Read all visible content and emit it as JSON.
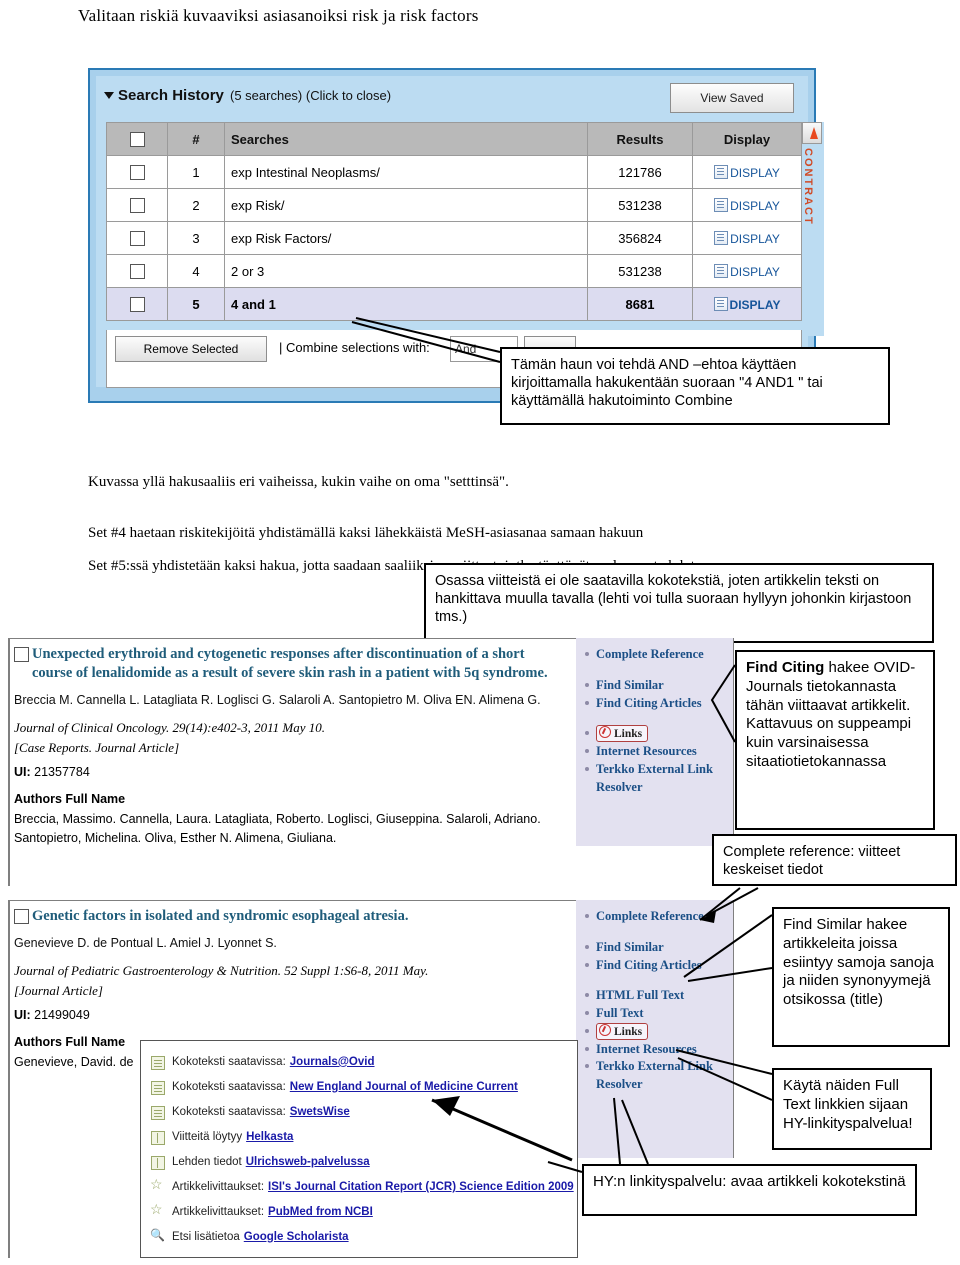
{
  "page_title": "Valitaan riskiä kuvaaviksi asiasanoiksi risk ja risk factors",
  "search_panel": {
    "header_title": "Search History",
    "header_count": "(5 searches) (Click to close)",
    "view_saved_label": "View Saved",
    "caret_icon": "triangle-down-icon",
    "columns": [
      "",
      "#",
      "Searches",
      "Results",
      "Display"
    ],
    "rows": [
      {
        "num": "1",
        "search": "exp Intestinal Neoplasms/",
        "results": "121786",
        "display": "DISPLAY"
      },
      {
        "num": "2",
        "search": "exp Risk/",
        "results": "531238",
        "display": "DISPLAY"
      },
      {
        "num": "3",
        "search": "exp Risk Factors/",
        "results": "356824",
        "display": "DISPLAY"
      },
      {
        "num": "4",
        "search": "2 or 3",
        "results": "531238",
        "display": "DISPLAY"
      },
      {
        "num": "5",
        "search": "4 and 1",
        "results": "8681",
        "display": "DISPLAY"
      }
    ],
    "contract_label": "CONTRACT",
    "remove_selected_label": "Remove Selected",
    "combine_label": "Combine selections with:",
    "combine_value": "And",
    "combine_go_label": ""
  },
  "callouts": {
    "and_note": "Tämän haun voi tehdä AND –ehtoa käyttäen kirjoittamalla hakukentään suoraan \"4 AND1 \" tai käyttämällä hakutoiminto Combine",
    "fulltext_note": "Osassa viitteistä ei ole  saatavilla kokotekstiä, joten artikkelin teksti on hankittava muulla tavalla (lehti voi tulla suoraan hyllyyn johonkin kirjastoon tms.)",
    "find_citing_bold": "Find Citing",
    "find_citing_rest": " hakee OVID-Journals tietokannasta tähän viittaavat artikkelit. Kattavuus on suppeampi kuin varsinaisessa sitaatiotietokannassa",
    "complete_ref": "Complete reference: viitteet keskeiset tiedot",
    "find_similar": "Find Similar hakee artikkeleita joissa esiintyy samoja sanoja ja niiden synonyymejä otsikossa (title)",
    "hy_use": "Käytä  näiden Full Text linkkien sijaan HY-linkityspalvelua!",
    "hy_service": "HY:n linkityspalvelu: avaa artikkeli kokotekstinä"
  },
  "body_text": {
    "line1": "Kuvassa yllä hakusaaliis eri vaiheissa, kukin vaihe on oma \"setttinsä\".",
    "line2": "Set #4 haetaan riskitekijöitä yhdistämällä kaksi lähekkäistä MeSH-asiasanaa samaan hakuun",
    "line3": "Set #5:ssä yhdistetään kaksi hakua, jotta saadaan saaliiksi ne viitteet, jotka täyttävät molemmat ehdot."
  },
  "records": [
    {
      "title": "Unexpected erythroid and cytogenetic responses after discontinuation of a short course of lenalidomide as a result of severe skin rash in a patient with 5q syndrome.",
      "authors": "Breccia M. Cannella L. Latagliata R. Loglisci G. Salaroli A. Santopietro M. Oliva EN. Alimena G.",
      "journal": "Journal of Clinical Oncology. 29(14):e402-3, 2011 May 10.",
      "pubtype": "[Case Reports. Journal Article]",
      "ui_label": "UI:",
      "ui_value": "21357784",
      "authors_full_name_heading": "Authors Full Name",
      "authors_full_name": "Breccia, Massimo. Cannella, Laura. Latagliata, Roberto. Loglisci, Giuseppina. Salaroli, Adriano. Santopietro, Michelina. Oliva, Esther N. Alimena, Giuliana."
    },
    {
      "title": "Genetic factors in isolated and syndromic esophageal atresia.",
      "authors": "Genevieve D. de Pontual L. Amiel J. Lyonnet S.",
      "journal": "Journal of Pediatric Gastroenterology & Nutrition. 52 Suppl 1:S6-8, 2011 May.",
      "pubtype": "[Journal Article]",
      "ui_label": "UI:",
      "ui_value": "21499049",
      "authors_full_name_heading": "Authors Full Name",
      "authors_full_name": "Genevieve, David. de"
    }
  ],
  "links_column_1": [
    "Complete Reference",
    "Find Similar",
    "Find Citing Articles",
    "Links",
    "Internet Resources",
    "Terkko External Link Resolver"
  ],
  "links_column_2": [
    "Complete Reference",
    "Find Similar",
    "Find Citing Articles",
    "HTML Full Text",
    "Full Text",
    "Links",
    "Internet Resources",
    "Terkko External Link Resolver"
  ],
  "fulltext_popup": [
    {
      "label": "Kokoteksti saatavissa:",
      "link": "Journals@Ovid",
      "icon": "document-check-icon"
    },
    {
      "label": "Kokoteksti saatavissa:",
      "link": "New England Journal of Medicine Current",
      "icon": "document-check-icon"
    },
    {
      "label": "Kokoteksti saatavissa:",
      "link": "SwetsWise",
      "icon": "document-check-icon"
    },
    {
      "label": "Viitteitä löytyy",
      "link": "Helkasta",
      "icon": "book-icon"
    },
    {
      "label": "Lehden tiedot",
      "link": "Ulrichsweb-palvelussa",
      "icon": "book-icon"
    },
    {
      "label": "Artikkelivittaukset:",
      "link": "ISI's Journal Citation Report (JCR) Science Edition 2009",
      "icon": "star-icon"
    },
    {
      "label": "Artikkelivittaukset:",
      "link": "PubMed from NCBI",
      "icon": "star-icon"
    },
    {
      "label": "Etsi lisätietoa",
      "link": "Google Scholarista",
      "icon": "magnifier-icon"
    }
  ],
  "colors": {
    "panel_border": "#2a7ab5",
    "panel_bg": "#bcdcf2",
    "link_blue": "#1b4f86",
    "title_blue": "#1f5c7a",
    "links_bg": "#e3e1f0",
    "contract_red": "#d04a26",
    "ft_link": "#1a1aa8"
  }
}
